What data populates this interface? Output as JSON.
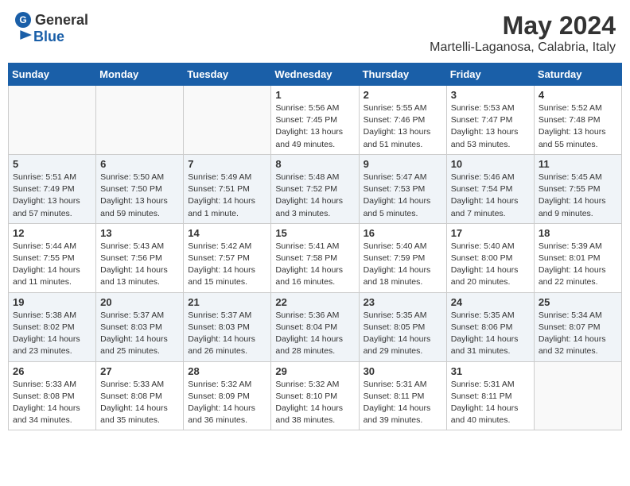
{
  "header": {
    "logo_general": "General",
    "logo_blue": "Blue",
    "month_year": "May 2024",
    "location": "Martelli-Laganosa, Calabria, Italy"
  },
  "weekdays": [
    "Sunday",
    "Monday",
    "Tuesday",
    "Wednesday",
    "Thursday",
    "Friday",
    "Saturday"
  ],
  "weeks": [
    [
      {
        "day": "",
        "sunrise": "",
        "sunset": "",
        "daylight": ""
      },
      {
        "day": "",
        "sunrise": "",
        "sunset": "",
        "daylight": ""
      },
      {
        "day": "",
        "sunrise": "",
        "sunset": "",
        "daylight": ""
      },
      {
        "day": "1",
        "sunrise": "Sunrise: 5:56 AM",
        "sunset": "Sunset: 7:45 PM",
        "daylight": "Daylight: 13 hours and 49 minutes."
      },
      {
        "day": "2",
        "sunrise": "Sunrise: 5:55 AM",
        "sunset": "Sunset: 7:46 PM",
        "daylight": "Daylight: 13 hours and 51 minutes."
      },
      {
        "day": "3",
        "sunrise": "Sunrise: 5:53 AM",
        "sunset": "Sunset: 7:47 PM",
        "daylight": "Daylight: 13 hours and 53 minutes."
      },
      {
        "day": "4",
        "sunrise": "Sunrise: 5:52 AM",
        "sunset": "Sunset: 7:48 PM",
        "daylight": "Daylight: 13 hours and 55 minutes."
      }
    ],
    [
      {
        "day": "5",
        "sunrise": "Sunrise: 5:51 AM",
        "sunset": "Sunset: 7:49 PM",
        "daylight": "Daylight: 13 hours and 57 minutes."
      },
      {
        "day": "6",
        "sunrise": "Sunrise: 5:50 AM",
        "sunset": "Sunset: 7:50 PM",
        "daylight": "Daylight: 13 hours and 59 minutes."
      },
      {
        "day": "7",
        "sunrise": "Sunrise: 5:49 AM",
        "sunset": "Sunset: 7:51 PM",
        "daylight": "Daylight: 14 hours and 1 minute."
      },
      {
        "day": "8",
        "sunrise": "Sunrise: 5:48 AM",
        "sunset": "Sunset: 7:52 PM",
        "daylight": "Daylight: 14 hours and 3 minutes."
      },
      {
        "day": "9",
        "sunrise": "Sunrise: 5:47 AM",
        "sunset": "Sunset: 7:53 PM",
        "daylight": "Daylight: 14 hours and 5 minutes."
      },
      {
        "day": "10",
        "sunrise": "Sunrise: 5:46 AM",
        "sunset": "Sunset: 7:54 PM",
        "daylight": "Daylight: 14 hours and 7 minutes."
      },
      {
        "day": "11",
        "sunrise": "Sunrise: 5:45 AM",
        "sunset": "Sunset: 7:55 PM",
        "daylight": "Daylight: 14 hours and 9 minutes."
      }
    ],
    [
      {
        "day": "12",
        "sunrise": "Sunrise: 5:44 AM",
        "sunset": "Sunset: 7:55 PM",
        "daylight": "Daylight: 14 hours and 11 minutes."
      },
      {
        "day": "13",
        "sunrise": "Sunrise: 5:43 AM",
        "sunset": "Sunset: 7:56 PM",
        "daylight": "Daylight: 14 hours and 13 minutes."
      },
      {
        "day": "14",
        "sunrise": "Sunrise: 5:42 AM",
        "sunset": "Sunset: 7:57 PM",
        "daylight": "Daylight: 14 hours and 15 minutes."
      },
      {
        "day": "15",
        "sunrise": "Sunrise: 5:41 AM",
        "sunset": "Sunset: 7:58 PM",
        "daylight": "Daylight: 14 hours and 16 minutes."
      },
      {
        "day": "16",
        "sunrise": "Sunrise: 5:40 AM",
        "sunset": "Sunset: 7:59 PM",
        "daylight": "Daylight: 14 hours and 18 minutes."
      },
      {
        "day": "17",
        "sunrise": "Sunrise: 5:40 AM",
        "sunset": "Sunset: 8:00 PM",
        "daylight": "Daylight: 14 hours and 20 minutes."
      },
      {
        "day": "18",
        "sunrise": "Sunrise: 5:39 AM",
        "sunset": "Sunset: 8:01 PM",
        "daylight": "Daylight: 14 hours and 22 minutes."
      }
    ],
    [
      {
        "day": "19",
        "sunrise": "Sunrise: 5:38 AM",
        "sunset": "Sunset: 8:02 PM",
        "daylight": "Daylight: 14 hours and 23 minutes."
      },
      {
        "day": "20",
        "sunrise": "Sunrise: 5:37 AM",
        "sunset": "Sunset: 8:03 PM",
        "daylight": "Daylight: 14 hours and 25 minutes."
      },
      {
        "day": "21",
        "sunrise": "Sunrise: 5:37 AM",
        "sunset": "Sunset: 8:03 PM",
        "daylight": "Daylight: 14 hours and 26 minutes."
      },
      {
        "day": "22",
        "sunrise": "Sunrise: 5:36 AM",
        "sunset": "Sunset: 8:04 PM",
        "daylight": "Daylight: 14 hours and 28 minutes."
      },
      {
        "day": "23",
        "sunrise": "Sunrise: 5:35 AM",
        "sunset": "Sunset: 8:05 PM",
        "daylight": "Daylight: 14 hours and 29 minutes."
      },
      {
        "day": "24",
        "sunrise": "Sunrise: 5:35 AM",
        "sunset": "Sunset: 8:06 PM",
        "daylight": "Daylight: 14 hours and 31 minutes."
      },
      {
        "day": "25",
        "sunrise": "Sunrise: 5:34 AM",
        "sunset": "Sunset: 8:07 PM",
        "daylight": "Daylight: 14 hours and 32 minutes."
      }
    ],
    [
      {
        "day": "26",
        "sunrise": "Sunrise: 5:33 AM",
        "sunset": "Sunset: 8:08 PM",
        "daylight": "Daylight: 14 hours and 34 minutes."
      },
      {
        "day": "27",
        "sunrise": "Sunrise: 5:33 AM",
        "sunset": "Sunset: 8:08 PM",
        "daylight": "Daylight: 14 hours and 35 minutes."
      },
      {
        "day": "28",
        "sunrise": "Sunrise: 5:32 AM",
        "sunset": "Sunset: 8:09 PM",
        "daylight": "Daylight: 14 hours and 36 minutes."
      },
      {
        "day": "29",
        "sunrise": "Sunrise: 5:32 AM",
        "sunset": "Sunset: 8:10 PM",
        "daylight": "Daylight: 14 hours and 38 minutes."
      },
      {
        "day": "30",
        "sunrise": "Sunrise: 5:31 AM",
        "sunset": "Sunset: 8:11 PM",
        "daylight": "Daylight: 14 hours and 39 minutes."
      },
      {
        "day": "31",
        "sunrise": "Sunrise: 5:31 AM",
        "sunset": "Sunset: 8:11 PM",
        "daylight": "Daylight: 14 hours and 40 minutes."
      },
      {
        "day": "",
        "sunrise": "",
        "sunset": "",
        "daylight": ""
      }
    ]
  ]
}
